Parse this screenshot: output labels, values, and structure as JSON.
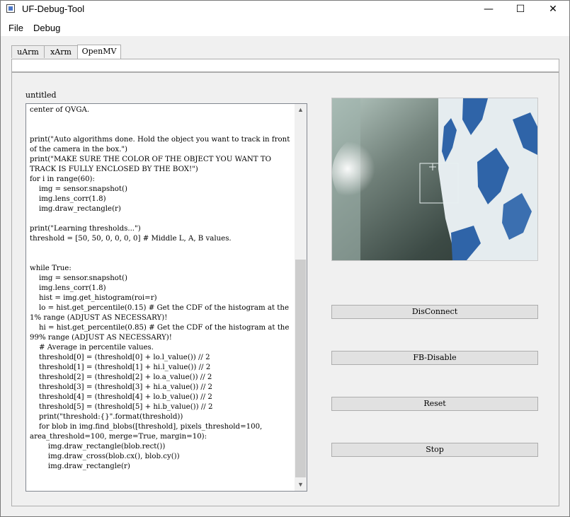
{
  "window": {
    "title": "UF-Debug-Tool",
    "controls": {
      "minimize": "—",
      "maximize": "☐",
      "close": "✕"
    }
  },
  "menu": {
    "items": [
      "File",
      "Debug"
    ]
  },
  "tabs": [
    {
      "label": "uArm",
      "active": false
    },
    {
      "label": "xArm",
      "active": false
    },
    {
      "label": "OpenMV",
      "active": true
    }
  ],
  "editor": {
    "title": "untitled",
    "code": "center of QVGA.\n\n\nprint(\"Auto algorithms done. Hold the object you want to track in front of the camera in the box.\")\nprint(\"MAKE SURE THE COLOR OF THE OBJECT YOU WANT TO TRACK IS FULLY ENCLOSED BY THE BOX!\")\nfor i in range(60):\n    img = sensor.snapshot()\n    img.lens_corr(1.8)\n    img.draw_rectangle(r)\n\nprint(\"Learning thresholds...\")\nthreshold = [50, 50, 0, 0, 0, 0] # Middle L, A, B values.\n\n\nwhile True:\n    img = sensor.snapshot()\n    img.lens_corr(1.8)\n    hist = img.get_histogram(roi=r)\n    lo = hist.get_percentile(0.15) # Get the CDF of the histogram at the 1% range (ADJUST AS NECESSARY)!\n    hi = hist.get_percentile(0.85) # Get the CDF of the histogram at the 99% range (ADJUST AS NECESSARY)!\n    # Average in percentile values.\n    threshold[0] = (threshold[0] + lo.l_value()) // 2\n    threshold[1] = (threshold[1] + hi.l_value()) // 2\n    threshold[2] = (threshold[2] + lo.a_value()) // 2\n    threshold[3] = (threshold[3] + hi.a_value()) // 2\n    threshold[4] = (threshold[4] + lo.b_value()) // 2\n    threshold[5] = (threshold[5] + hi.b_value()) // 2\n    print(\"threshold:{}\".format(threshold))\n    for blob in img.find_blobs([threshold], pixels_threshold=100, area_threshold=100, merge=True, margin=10):\n        img.draw_rectangle(blob.rect())\n        img.draw_cross(blob.cx(), blob.cy())\n        img.draw_rectangle(r)"
  },
  "scrollbar": {
    "up": "▲",
    "down": "▼"
  },
  "buttons": {
    "disconnect": "DisConnect",
    "fb_disable": "FB-Disable",
    "reset": "Reset",
    "stop": "Stop"
  },
  "colors": {
    "background": "#f0f0f0",
    "button": "#e1e1e1",
    "camera_blue": "#2f64a8"
  }
}
